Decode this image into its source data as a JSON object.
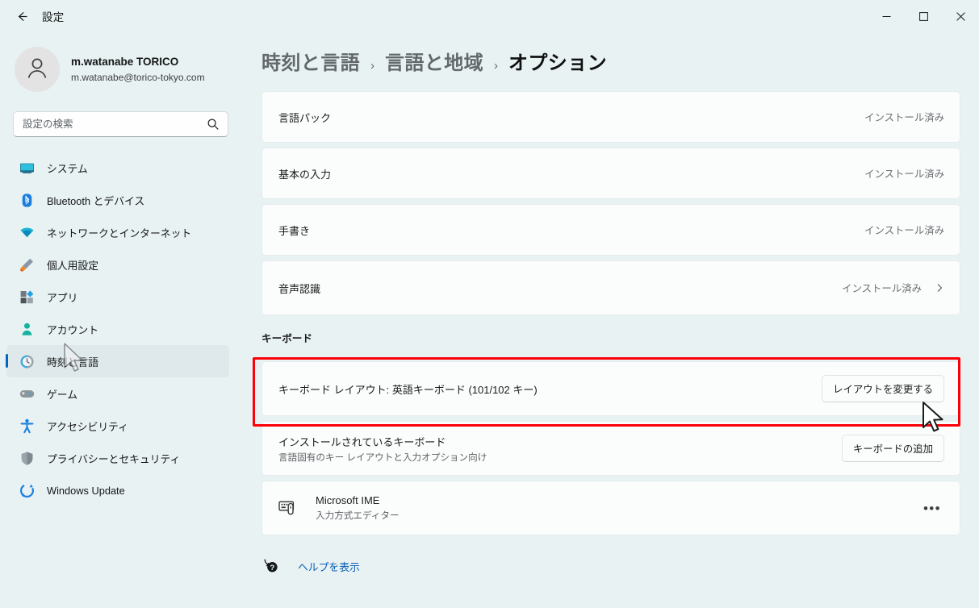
{
  "window": {
    "title": "設定",
    "back_icon": "back-arrow-icon",
    "controls": [
      {
        "name": "minimize-button",
        "glyph": "minimize-icon"
      },
      {
        "name": "maximize-button",
        "glyph": "maximize-icon"
      },
      {
        "name": "close-button",
        "glyph": "close-icon"
      }
    ]
  },
  "sidebar": {
    "account": {
      "name": "m.watanabe TORICO",
      "email": "m.watanabe@torico-tokyo.com",
      "avatar_icon": "person-avatar-icon"
    },
    "search": {
      "placeholder": "設定の検索",
      "value": "",
      "icon": "search-icon"
    },
    "items": [
      {
        "label": "システム",
        "icon": "system-icon",
        "selected": false
      },
      {
        "label": "Bluetooth とデバイス",
        "icon": "bluetooth-icon",
        "selected": false
      },
      {
        "label": "ネットワークとインターネット",
        "icon": "network-wifi-icon",
        "selected": false
      },
      {
        "label": "個人用設定",
        "icon": "personalization-brush-icon",
        "selected": false
      },
      {
        "label": "アプリ",
        "icon": "apps-icon",
        "selected": false
      },
      {
        "label": "アカウント",
        "icon": "accounts-person-icon",
        "selected": false
      },
      {
        "label": "時刻と言語",
        "icon": "time-language-clock-icon",
        "selected": true
      },
      {
        "label": "ゲーム",
        "icon": "gaming-controller-icon",
        "selected": false
      },
      {
        "label": "アクセシビリティ",
        "icon": "accessibility-icon",
        "selected": false
      },
      {
        "label": "プライバシーとセキュリティ",
        "icon": "privacy-shield-icon",
        "selected": false
      },
      {
        "label": "Windows Update",
        "icon": "windows-update-icon",
        "selected": false
      }
    ]
  },
  "main": {
    "breadcrumb": {
      "first": "時刻と言語",
      "separator1": "›",
      "second": "言語と地域",
      "separator2": "›",
      "current": "オプション"
    },
    "feature_cards": [
      {
        "title": "言語パック",
        "status": "インストール済み",
        "has_chevron": false
      },
      {
        "title": "基本の入力",
        "status": "インストール済み",
        "has_chevron": false
      },
      {
        "title": "手書き",
        "status": "インストール済み",
        "has_chevron": false
      },
      {
        "title": "音声認識",
        "status": "インストール済み",
        "has_chevron": true
      }
    ],
    "keyboard_section": {
      "heading": "キーボード",
      "layout_row": {
        "title": "キーボード レイアウト: 英語キーボード (101/102 キー)",
        "button": "レイアウトを変更する"
      },
      "installed_row": {
        "title": "インストールされているキーボード",
        "subtitle": "言語固有のキー レイアウトと入力オプション向け",
        "button": "キーボードの追加"
      },
      "ime_row": {
        "icon": "keyboard-ime-icon",
        "title": "Microsoft IME",
        "subtitle": "入力方式エディター",
        "more_glyph": "•••"
      }
    },
    "help": {
      "icon": "help-question-icon",
      "label": "ヘルプを表示"
    }
  },
  "annotation": {
    "type": "rectangle-highlight",
    "color": "#fb0007"
  },
  "colors": {
    "background": "#e8f2f3",
    "card": "#fbfcfc",
    "accent": "#0067c0",
    "link": "#0a5fb4",
    "annotation": "#fb0007"
  }
}
